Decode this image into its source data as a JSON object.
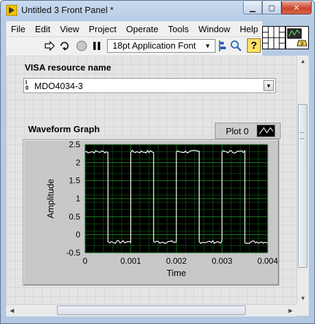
{
  "window": {
    "title": "Untitled 3 Front Panel *",
    "buttons": {
      "minimize": "▁",
      "maximize": "▢",
      "close": "✕"
    }
  },
  "menu": [
    "File",
    "Edit",
    "View",
    "Project",
    "Operate",
    "Tools",
    "Window",
    "Help"
  ],
  "toolbar": {
    "run_icon": "run-arrow-icon",
    "run_continuously_icon": "run-continuously-icon",
    "abort_icon": "abort-stop-icon",
    "pause_icon": "pause-icon",
    "font_select": "18pt Application Font",
    "align_icon": "align-objects-icon",
    "search_icon": "search-icon",
    "help_icon": "context-help-icon",
    "help_glyph": "?"
  },
  "visa": {
    "label": "VISA resource name",
    "glyph_top": "I",
    "glyph_bottom": "0",
    "value": "MDO4034-3"
  },
  "graph": {
    "label": "Waveform Graph",
    "legend_label": "Plot 0",
    "plot_color": "#ffffff",
    "background_color": "#000000",
    "grid_color": "#1a7a1a"
  },
  "chart_data": {
    "type": "line",
    "title": "Waveform Graph",
    "xlabel": "Time",
    "ylabel": "Amplitude",
    "xlim": [
      0,
      0.004
    ],
    "ylim": [
      -0.5,
      2.5
    ],
    "x_ticks": [
      "0",
      "0.001",
      "0.002",
      "0.003",
      "0.004"
    ],
    "y_ticks": [
      "2.5",
      "2",
      "1.5",
      "1",
      "0.5",
      "0",
      "-0.5"
    ],
    "x_tick_values": [
      0,
      0.001,
      0.002,
      0.003,
      0.004
    ],
    "y_tick_values": [
      2.5,
      2,
      1.5,
      1,
      0.5,
      0,
      -0.5
    ],
    "series": [
      {
        "name": "Plot 0",
        "period": 0.001,
        "high": 2.3,
        "low": -0.2,
        "duty_cycle": 0.5,
        "first_edge": 0.0005
      }
    ],
    "grid": true
  }
}
